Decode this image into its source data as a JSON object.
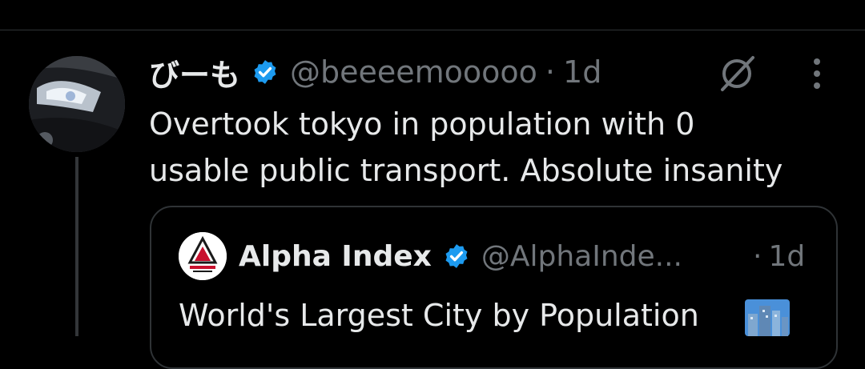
{
  "tweet": {
    "author": {
      "display_name": "びーも",
      "handle": "@beeeemooooo",
      "verified": true,
      "avatar": "car-headlight-photo"
    },
    "separator": "·",
    "time": "1d",
    "text_line1": "Overtook tokyo in population with 0",
    "text_line2": "usable public transport. Absolute insanity",
    "actions": {
      "grok_icon": "grok-slash-icon",
      "more_icon": "more-vertical-icon"
    }
  },
  "quote": {
    "author": {
      "display_name": "Alpha Index",
      "handle": "@AlphaInde...",
      "verified": true,
      "avatar": "alpha-index-logo"
    },
    "separator": "·",
    "time": "1d",
    "text": "World's Largest City by Population",
    "emoji": "cityscape-icon"
  },
  "colors": {
    "background": "#000000",
    "text": "#e7e9ea",
    "secondary": "#71767b",
    "verified": "#1d9bf0",
    "divider": "#2f3336",
    "logo_red": "#c8102e"
  }
}
